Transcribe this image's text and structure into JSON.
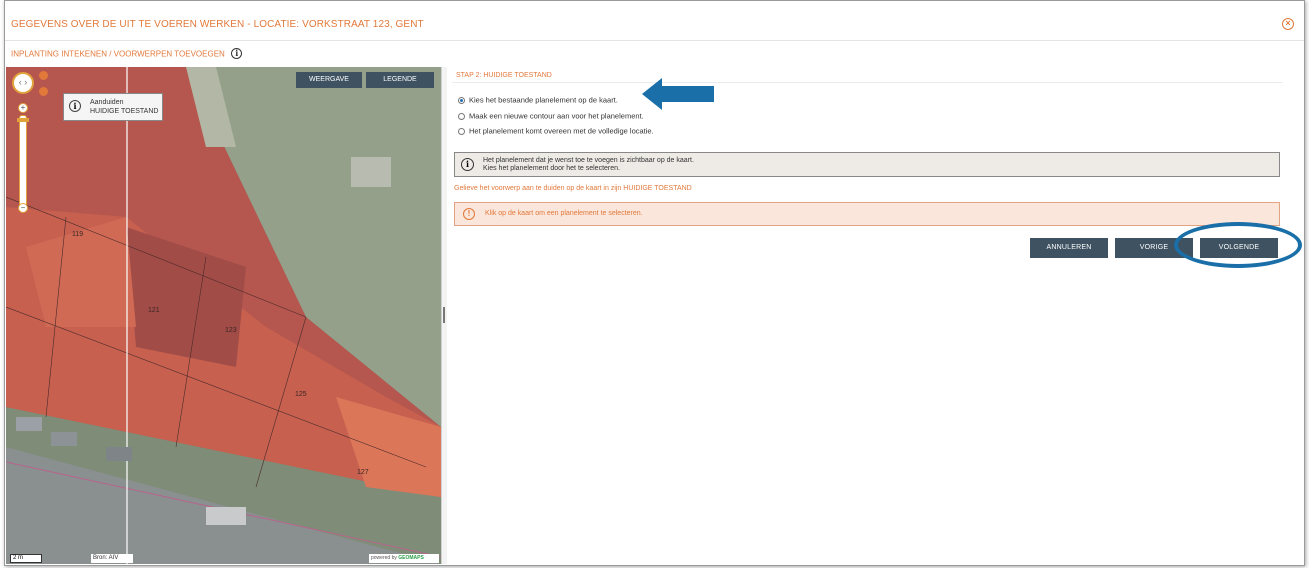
{
  "dialog": {
    "title": "GEGEVENS OVER DE UIT TE VOEREN WERKEN - LOCATIE: VORKSTRAAT 123, GENT",
    "subtitle": "INPLANTING INTEKENEN / VOORWERPEN TOEVOEGEN"
  },
  "map": {
    "weergave_label": "WEERGAVE",
    "legende_label": "LEGENDE",
    "tooltip_line1": "Aanduiden",
    "tooltip_line2": "HUIDIGE TOESTAND",
    "house_numbers": [
      "119",
      "121",
      "123",
      "125",
      "127"
    ],
    "scale_label": "2 m",
    "source_label": "Bron: AIV",
    "powered_prefix": "powered by",
    "powered_brand": "GEOMAPS"
  },
  "step": {
    "title": "STAP 2: HUIDIGE TOESTAND",
    "options": [
      {
        "label": "Kies het bestaande planelement op de kaart.",
        "selected": true
      },
      {
        "label": "Maak een nieuwe contour aan voor het planelement.",
        "selected": false
      },
      {
        "label": "Het planelement komt overeen met de volledige locatie.",
        "selected": false
      }
    ],
    "info_line1": "Het planelement dat je wenst toe te voegen is zichtbaar op de kaart.",
    "info_line2": "Kies het planelement door het te selecteren.",
    "notice": "Gelieve het voorwerp aan te duiden op de kaart in zijn HUIDIGE TOESTAND",
    "warning": "Klik op de kaart om een planelement te selecteren."
  },
  "buttons": {
    "annuleren": "ANNULEREN",
    "vorige": "VORIGE",
    "volgende": "VOLGENDE"
  },
  "colors": {
    "accent": "#e2793b",
    "button": "#3e5261",
    "annotation": "#1a6fa8"
  }
}
